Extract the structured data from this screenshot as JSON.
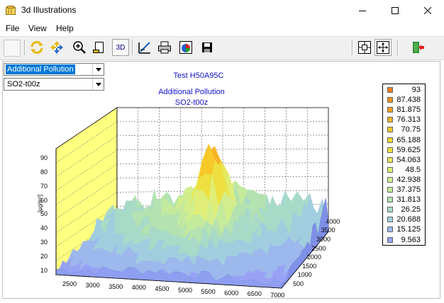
{
  "window": {
    "title": "3d Illustrations"
  },
  "menu": [
    "File",
    "View",
    "Help"
  ],
  "toolbar": {
    "mode_3d_label": "3D"
  },
  "dropdowns": {
    "parameter": "Additional Pollution",
    "substance": "SO2-t00z"
  },
  "chart": {
    "title_line1": "Test H50A95C",
    "title_line2": "Additional Pollution",
    "title_line3": "SO2-t00z",
    "z_axis_label": "[µg/m³]",
    "z_ticks": [
      "90",
      "80",
      "70",
      "60",
      "50",
      "40",
      "30",
      "20",
      "10"
    ],
    "x_ticks": [
      "2500",
      "3000",
      "3500",
      "4000",
      "4500",
      "5000",
      "5500",
      "6000",
      "6500",
      "7000"
    ],
    "y_ticks": [
      "500",
      "1000",
      "1500",
      "2000",
      "2500",
      "3000",
      "3500",
      "4000"
    ]
  },
  "colors": {
    "accent_text": "#1010c8",
    "wall": "#ffff80"
  },
  "chart_data": {
    "type": "surface",
    "title": "Test H50A95C",
    "subtitle": "Additional Pollution SO2-t00z",
    "zlabel": "[µg/m³]",
    "x_range": [
      2500,
      7000
    ],
    "y_range": [
      500,
      4000
    ],
    "z_range": [
      10,
      90
    ],
    "legend": {
      "placement": "right",
      "levels": [
        {
          "value": "93",
          "color": "#f08020"
        },
        {
          "value": "87.438",
          "color": "#f2901e"
        },
        {
          "value": "81.875",
          "color": "#f4a020"
        },
        {
          "value": "76.313",
          "color": "#f6b424"
        },
        {
          "value": "70.75",
          "color": "#f6c828"
        },
        {
          "value": "65.188",
          "color": "#f2d630"
        },
        {
          "value": "59.625",
          "color": "#eee040"
        },
        {
          "value": "54.063",
          "color": "#e6e858"
        },
        {
          "value": "48.5",
          "color": "#e0ee78"
        },
        {
          "value": "42.938",
          "color": "#d2ee8c"
        },
        {
          "value": "37.375",
          "color": "#c4ea9c"
        },
        {
          "value": "31.813",
          "color": "#b4e2b0"
        },
        {
          "value": "26.25",
          "color": "#a8dac8"
        },
        {
          "value": "20.688",
          "color": "#a0cede"
        },
        {
          "value": "15.125",
          "color": "#9cb8ec"
        },
        {
          "value": "9.563",
          "color": "#98a2f4"
        }
      ]
    }
  }
}
